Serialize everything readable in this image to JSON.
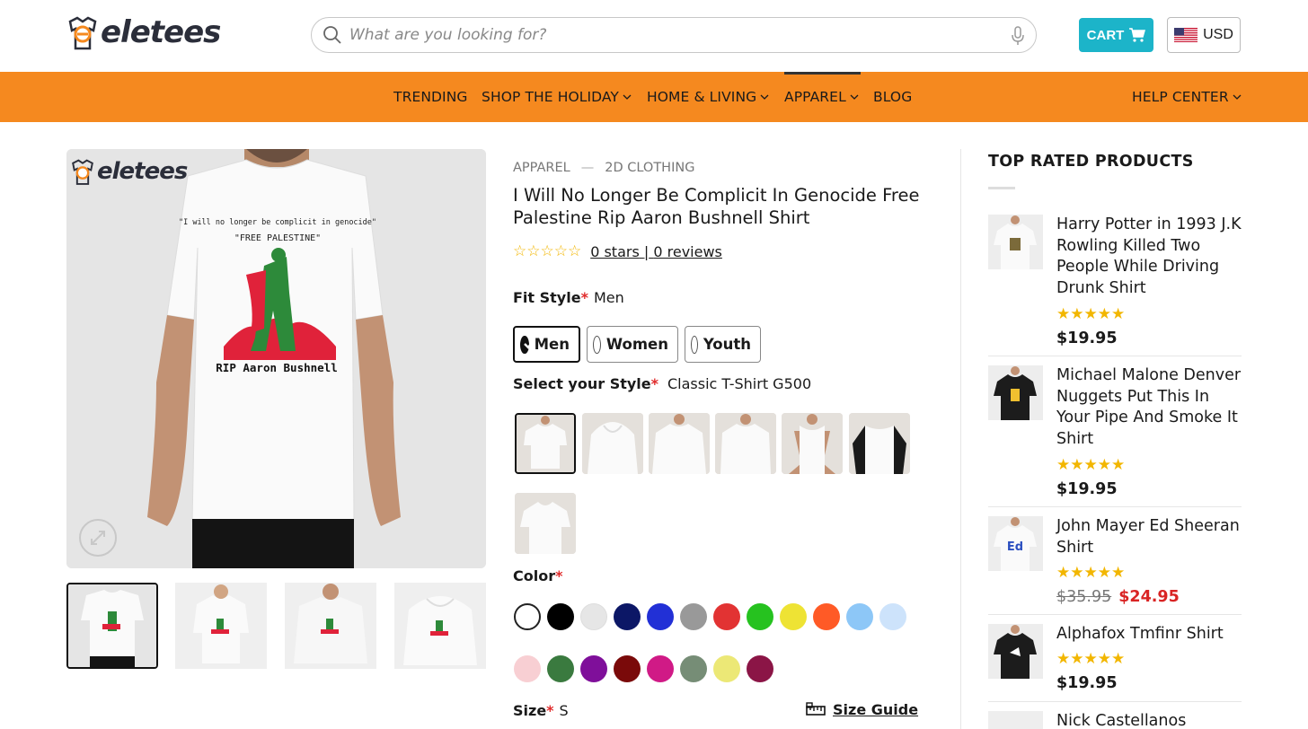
{
  "header": {
    "logo_text": "eletees",
    "search_placeholder": "What are you looking for?",
    "cart_label": "CART",
    "currency_label": "USD"
  },
  "nav": {
    "items": [
      {
        "label": "TRENDING"
      },
      {
        "label": "SHOP THE HOLIDAY"
      },
      {
        "label": "HOME & LIVING"
      },
      {
        "label": "APPAREL"
      },
      {
        "label": "BLOG"
      }
    ],
    "help_center": "HELP CENTER"
  },
  "product_image": {
    "watermark": "eletees",
    "shirt_text_line1": "\"I will no longer be complicit in genocide\"",
    "shirt_text_line2": "\"FREE PALESTINE\"",
    "shirt_text_line3": "RIP Aaron Bushnell"
  },
  "product": {
    "breadcrumb": [
      "APPAREL",
      "—",
      "2D CLOTHING"
    ],
    "title": "I Will No Longer Be Complicit In Genocide Free Palestine Rip Aaron Bushnell Shirt",
    "stars": "☆☆☆☆☆",
    "rating_stars_text": "0 stars",
    "rating_sep": "|",
    "rating_reviews_text": "0 reviews",
    "fit_style_label": "Fit Style",
    "fit_style_value": "Men",
    "fit_options": [
      "Men",
      "Women",
      "Youth"
    ],
    "style_label": "Select your Style",
    "style_value": "Classic T-Shirt G500",
    "color_label": "Color",
    "colors_row1": [
      "#ffffff",
      "#000000",
      "#e6e6e6",
      "#0c1766",
      "#2230d6",
      "#999999",
      "#e23333",
      "#26c21f",
      "#eee334",
      "#ff5a26",
      "#8dc7f7",
      "#cde3fb"
    ],
    "colors_row2": [
      "#f8cfd3",
      "#3a7a3f",
      "#7f0f9a",
      "#7a0a0a",
      "#d01a86",
      "#768d76",
      "#ece876",
      "#8b1546"
    ],
    "size_label": "Size",
    "size_value": "S",
    "size_guide": "Size Guide",
    "required_mark": "*"
  },
  "sidebar": {
    "title": "TOP RATED PRODUCTS",
    "products": [
      {
        "name": "Harry Potter in 1993 J.K Rowling Killed Two People While Driving Drunk Shirt",
        "stars": "★★★★★",
        "price": "$19.95"
      },
      {
        "name": "Michael Malone Denver Nuggets Put This In Your Pipe And Smoke It Shirt",
        "stars": "★★★★★",
        "price": "$19.95"
      },
      {
        "name": "John Mayer Ed Sheeran Shirt",
        "stars": "★★★★★",
        "old_price": "$35.95",
        "price": "$24.95"
      },
      {
        "name": "Alphafox Tmfinr Shirt",
        "stars": "★★★★★",
        "price": "$19.95"
      },
      {
        "name": "Nick Castellanos"
      }
    ]
  }
}
